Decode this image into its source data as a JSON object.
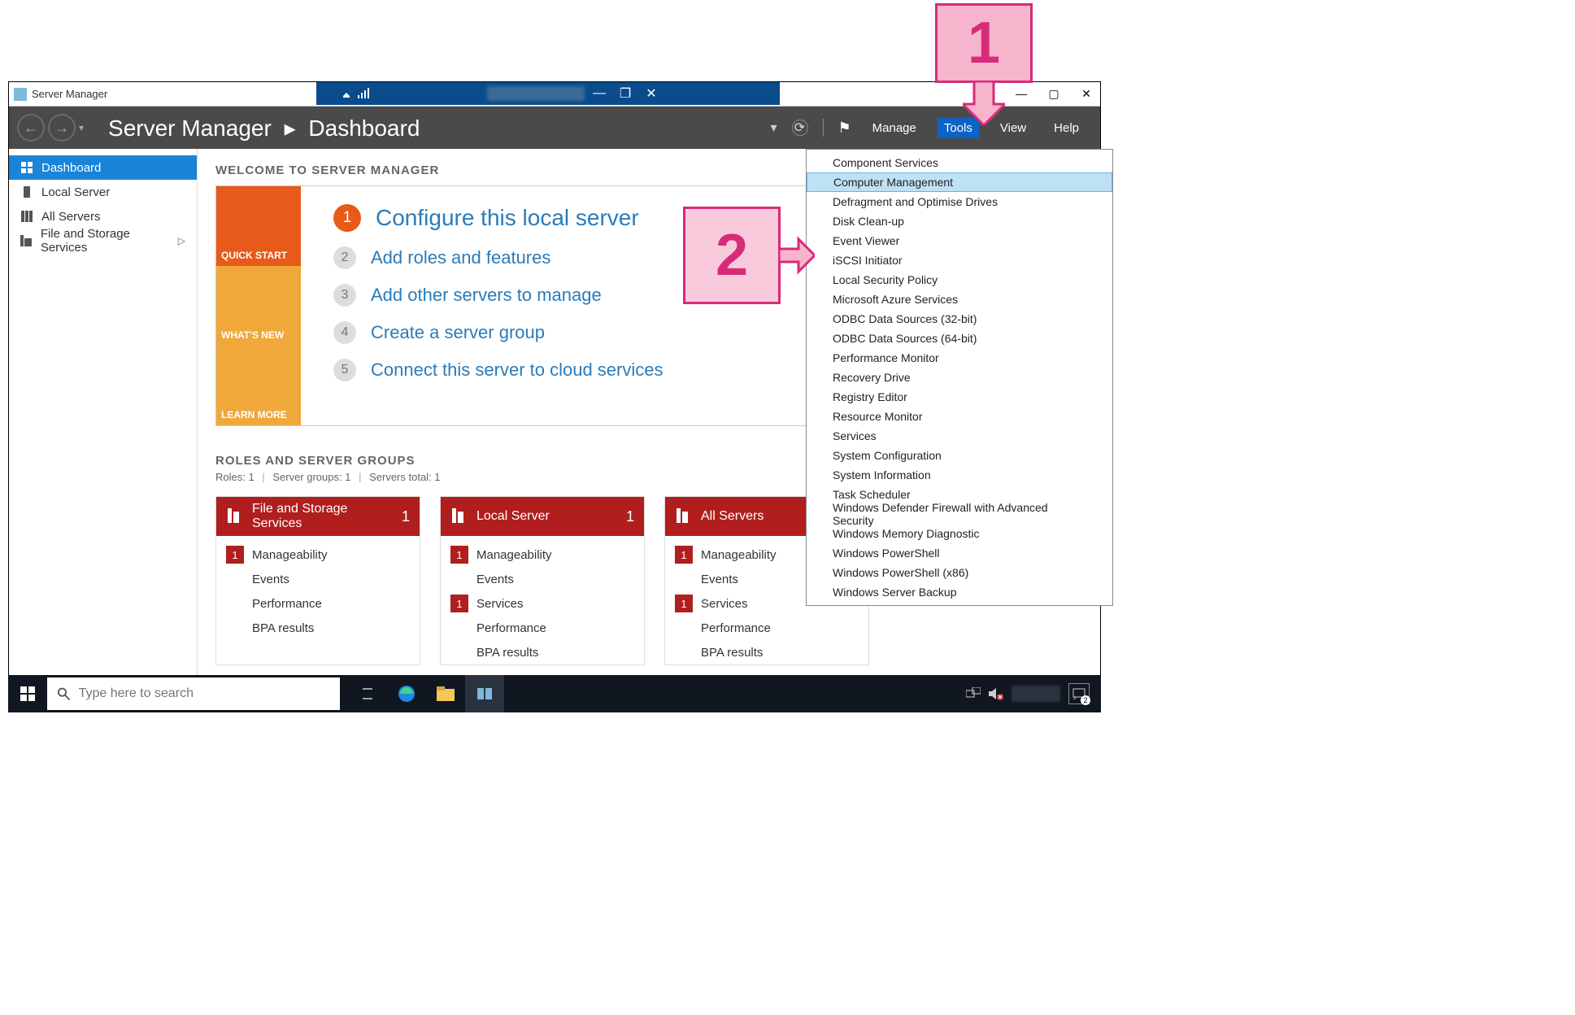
{
  "window": {
    "app_icon_name": "server-manager-icon",
    "title": "Server Manager",
    "minimize": "—",
    "maximize": "▢",
    "close": "✕"
  },
  "breadcrumb": {
    "app": "Server Manager",
    "sep": "▸",
    "page": "Dashboard"
  },
  "header_menus": {
    "manage": "Manage",
    "tools": "Tools",
    "view": "View",
    "help": "Help",
    "selected": "tools"
  },
  "sidebar": {
    "items": [
      {
        "icon": "dashboard-icon",
        "label": "Dashboard",
        "selected": true
      },
      {
        "icon": "server-icon",
        "label": "Local Server"
      },
      {
        "icon": "servers-icon",
        "label": "All Servers"
      },
      {
        "icon": "storage-icon",
        "label": "File and Storage Services",
        "chevron": "▷"
      }
    ]
  },
  "welcome": {
    "heading": "WELCOME TO SERVER MANAGER",
    "tiles": [
      {
        "label": "QUICK START",
        "class": "t-orange"
      },
      {
        "label": "WHAT'S NEW",
        "class": "t-gold1"
      },
      {
        "label": "LEARN MORE",
        "class": "t-gold2"
      }
    ],
    "steps": [
      {
        "num": "1",
        "text": "Configure this local server",
        "first": true
      },
      {
        "num": "2",
        "text": "Add roles and features"
      },
      {
        "num": "3",
        "text": "Add other servers to manage"
      },
      {
        "num": "4",
        "text": "Create a server group"
      },
      {
        "num": "5",
        "text": "Connect this server to cloud services"
      }
    ]
  },
  "roles": {
    "heading": "ROLES AND SERVER GROUPS",
    "sub_roles": "Roles: 1",
    "sub_groups": "Server groups: 1",
    "sub_total": "Servers total: 1",
    "tiles": [
      {
        "name": "File and Storage Services",
        "count": "1",
        "rows": [
          {
            "badge": "1",
            "label": "Manageability"
          },
          {
            "badge": "",
            "label": "Events"
          },
          {
            "badge": "",
            "label": "Performance"
          },
          {
            "badge": "",
            "label": "BPA results"
          }
        ]
      },
      {
        "name": "Local Server",
        "count": "1",
        "rows": [
          {
            "badge": "1",
            "label": "Manageability"
          },
          {
            "badge": "",
            "label": "Events"
          },
          {
            "badge": "1",
            "label": "Services"
          },
          {
            "badge": "",
            "label": "Performance"
          },
          {
            "badge": "",
            "label": "BPA results"
          }
        ]
      },
      {
        "name": "All Servers",
        "count": "1",
        "rows": [
          {
            "badge": "1",
            "label": "Manageability"
          },
          {
            "badge": "",
            "label": "Events"
          },
          {
            "badge": "1",
            "label": "Services"
          },
          {
            "badge": "",
            "label": "Performance"
          },
          {
            "badge": "",
            "label": "BPA results"
          }
        ]
      }
    ]
  },
  "tools_menu": {
    "items": [
      "Component Services",
      "Computer Management",
      "Defragment and Optimise Drives",
      "Disk Clean-up",
      "Event Viewer",
      "iSCSI Initiator",
      "Local Security Policy",
      "Microsoft Azure Services",
      "ODBC Data Sources (32-bit)",
      "ODBC Data Sources (64-bit)",
      "Performance Monitor",
      "Recovery Drive",
      "Registry Editor",
      "Resource Monitor",
      "Services",
      "System Configuration",
      "System Information",
      "Task Scheduler",
      "Windows Defender Firewall with Advanced Security",
      "Windows Memory Diagnostic",
      "Windows PowerShell",
      "Windows PowerShell (x86)",
      "Windows Server Backup"
    ],
    "selected_index": 1
  },
  "callouts": {
    "one": "1",
    "two": "2"
  },
  "taskbar": {
    "search_placeholder": "Type here to search",
    "notif_count": "2"
  }
}
